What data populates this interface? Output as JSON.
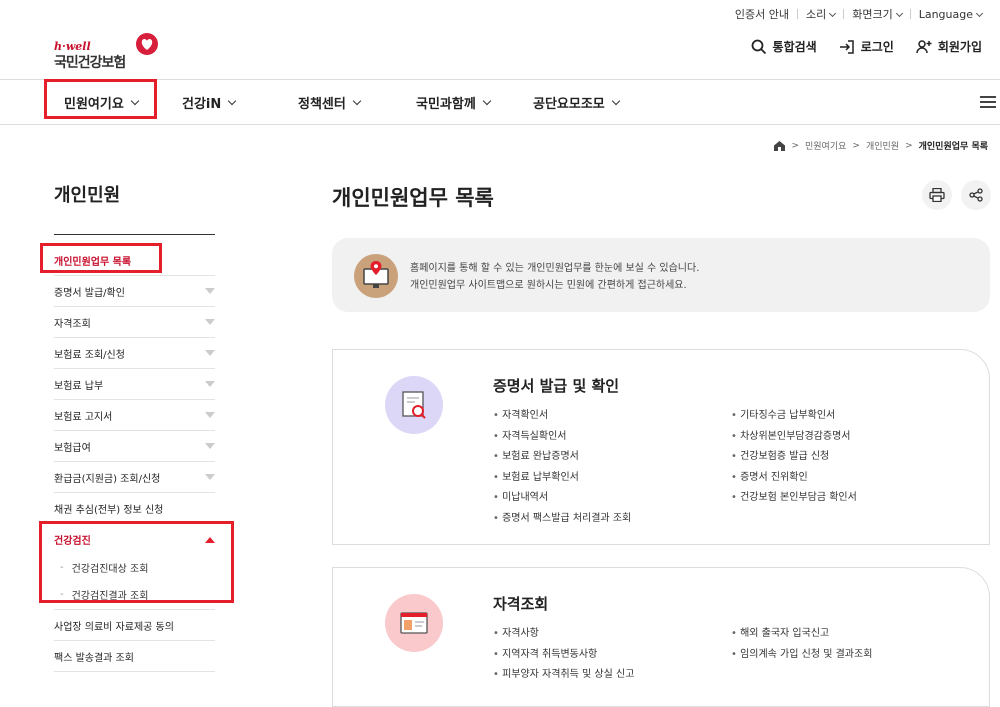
{
  "util": {
    "items": [
      "인증서 안내",
      "소리",
      "화면크기",
      "Language"
    ]
  },
  "logo": {
    "sub": "h·well",
    "name": "국민건강보험"
  },
  "header": {
    "search": "통합검색",
    "login": "로그인",
    "join": "회원가입"
  },
  "gnb": {
    "items": [
      "민원여기요",
      "건강iN",
      "정책센터",
      "국민과함께",
      "공단요모조모"
    ]
  },
  "breadcrumb": {
    "items": [
      "민원여기요",
      "개인민원",
      "개인민원업무 목록"
    ]
  },
  "lnb": {
    "title": "개인민원",
    "items": [
      "개인민원업무 목록",
      "증명서 발급/확인",
      "자격조회",
      "보험료 조회/신청",
      "보험료 납부",
      "보험료 고지서",
      "보험급여",
      "환급금(지원금) 조회/신청",
      "채권 추심(전부) 정보 신청",
      "건강검진"
    ],
    "sub": [
      "건강검진대상 조회",
      "건강검진결과 조회"
    ],
    "after": [
      "사업장 의료비 자료제공 동의",
      "팩스 발송결과 조회"
    ]
  },
  "main": {
    "title": "개인민원업무 목록",
    "info": [
      "홈페이지를 통해 할 수 있는 개인민원업무를 한눈에 보실 수 있습니다.",
      "개인민원업무 사이트맵으로 원하시는 민원에 간편하게 접근하세요."
    ],
    "cards": [
      {
        "title": "증명서 발급 및 확인",
        "left": [
          "자격확인서",
          "자격득실확인서",
          "보험료 완납증명서",
          "보험료 납부확인서",
          "미납내역서",
          "증명서 팩스발급 처리결과 조회"
        ],
        "right": [
          "기타징수금 납부확인서",
          "차상위본인부담경감증명서",
          "건강보험증 발급 신청",
          "증명서 진위확인",
          "건강보험 본인부담금 확인서"
        ]
      },
      {
        "title": "자격조회",
        "left": [
          "자격사항",
          "지역자격 취득변동사항",
          "피부양자 자격취득 및 상실 신고"
        ],
        "right": [
          "해외 출국자 입국신고",
          "임의계속 가입 신청 및 결과조회"
        ]
      }
    ]
  },
  "colors": {
    "accent": "#e41e2b",
    "brand": "#c8102e"
  }
}
